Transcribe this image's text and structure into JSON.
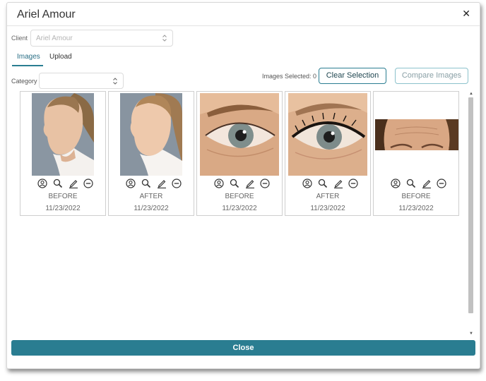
{
  "modal": {
    "title": "Ariel Amour",
    "close_icon": "close-icon"
  },
  "client": {
    "label": "Client",
    "value": "Ariel Amour"
  },
  "tabs": [
    {
      "label": "Images",
      "active": true
    },
    {
      "label": "Upload",
      "active": false
    }
  ],
  "category": {
    "label": "Category",
    "value": ""
  },
  "selection": {
    "count_text": "Images Selected: 0",
    "clear_label": "Clear Selection",
    "compare_label": "Compare Images"
  },
  "cards": [
    {
      "type": "BEFORE",
      "date": "11/23/2022",
      "photo": "face-profile-left"
    },
    {
      "type": "AFTER",
      "date": "11/23/2022",
      "photo": "face-profile-right"
    },
    {
      "type": "BEFORE",
      "date": "11/23/2022",
      "photo": "eye-closeup"
    },
    {
      "type": "AFTER",
      "date": "11/23/2022",
      "photo": "eye-closeup-lashes"
    },
    {
      "type": "BEFORE",
      "date": "11/23/2022",
      "photo": "forehead"
    }
  ],
  "card_actions": [
    "user-circle-icon",
    "magnifier-icon",
    "pencil-icon",
    "minus-circle-icon"
  ],
  "footer": {
    "close_label": "Close"
  },
  "colors": {
    "accent": "#2a7d91",
    "accent_light": "#8cc2cc",
    "border": "#cfcfcf"
  }
}
